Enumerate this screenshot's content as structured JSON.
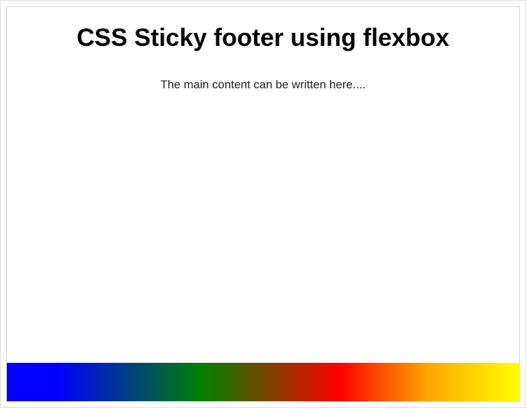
{
  "header": {
    "title": "CSS Sticky footer using flexbox"
  },
  "content": {
    "text": "The main content can be written here...."
  },
  "footer": {
    "gradient_colors": [
      "#0000ff",
      "#008000",
      "#ff0000",
      "#ffa500",
      "#ffff00"
    ]
  }
}
